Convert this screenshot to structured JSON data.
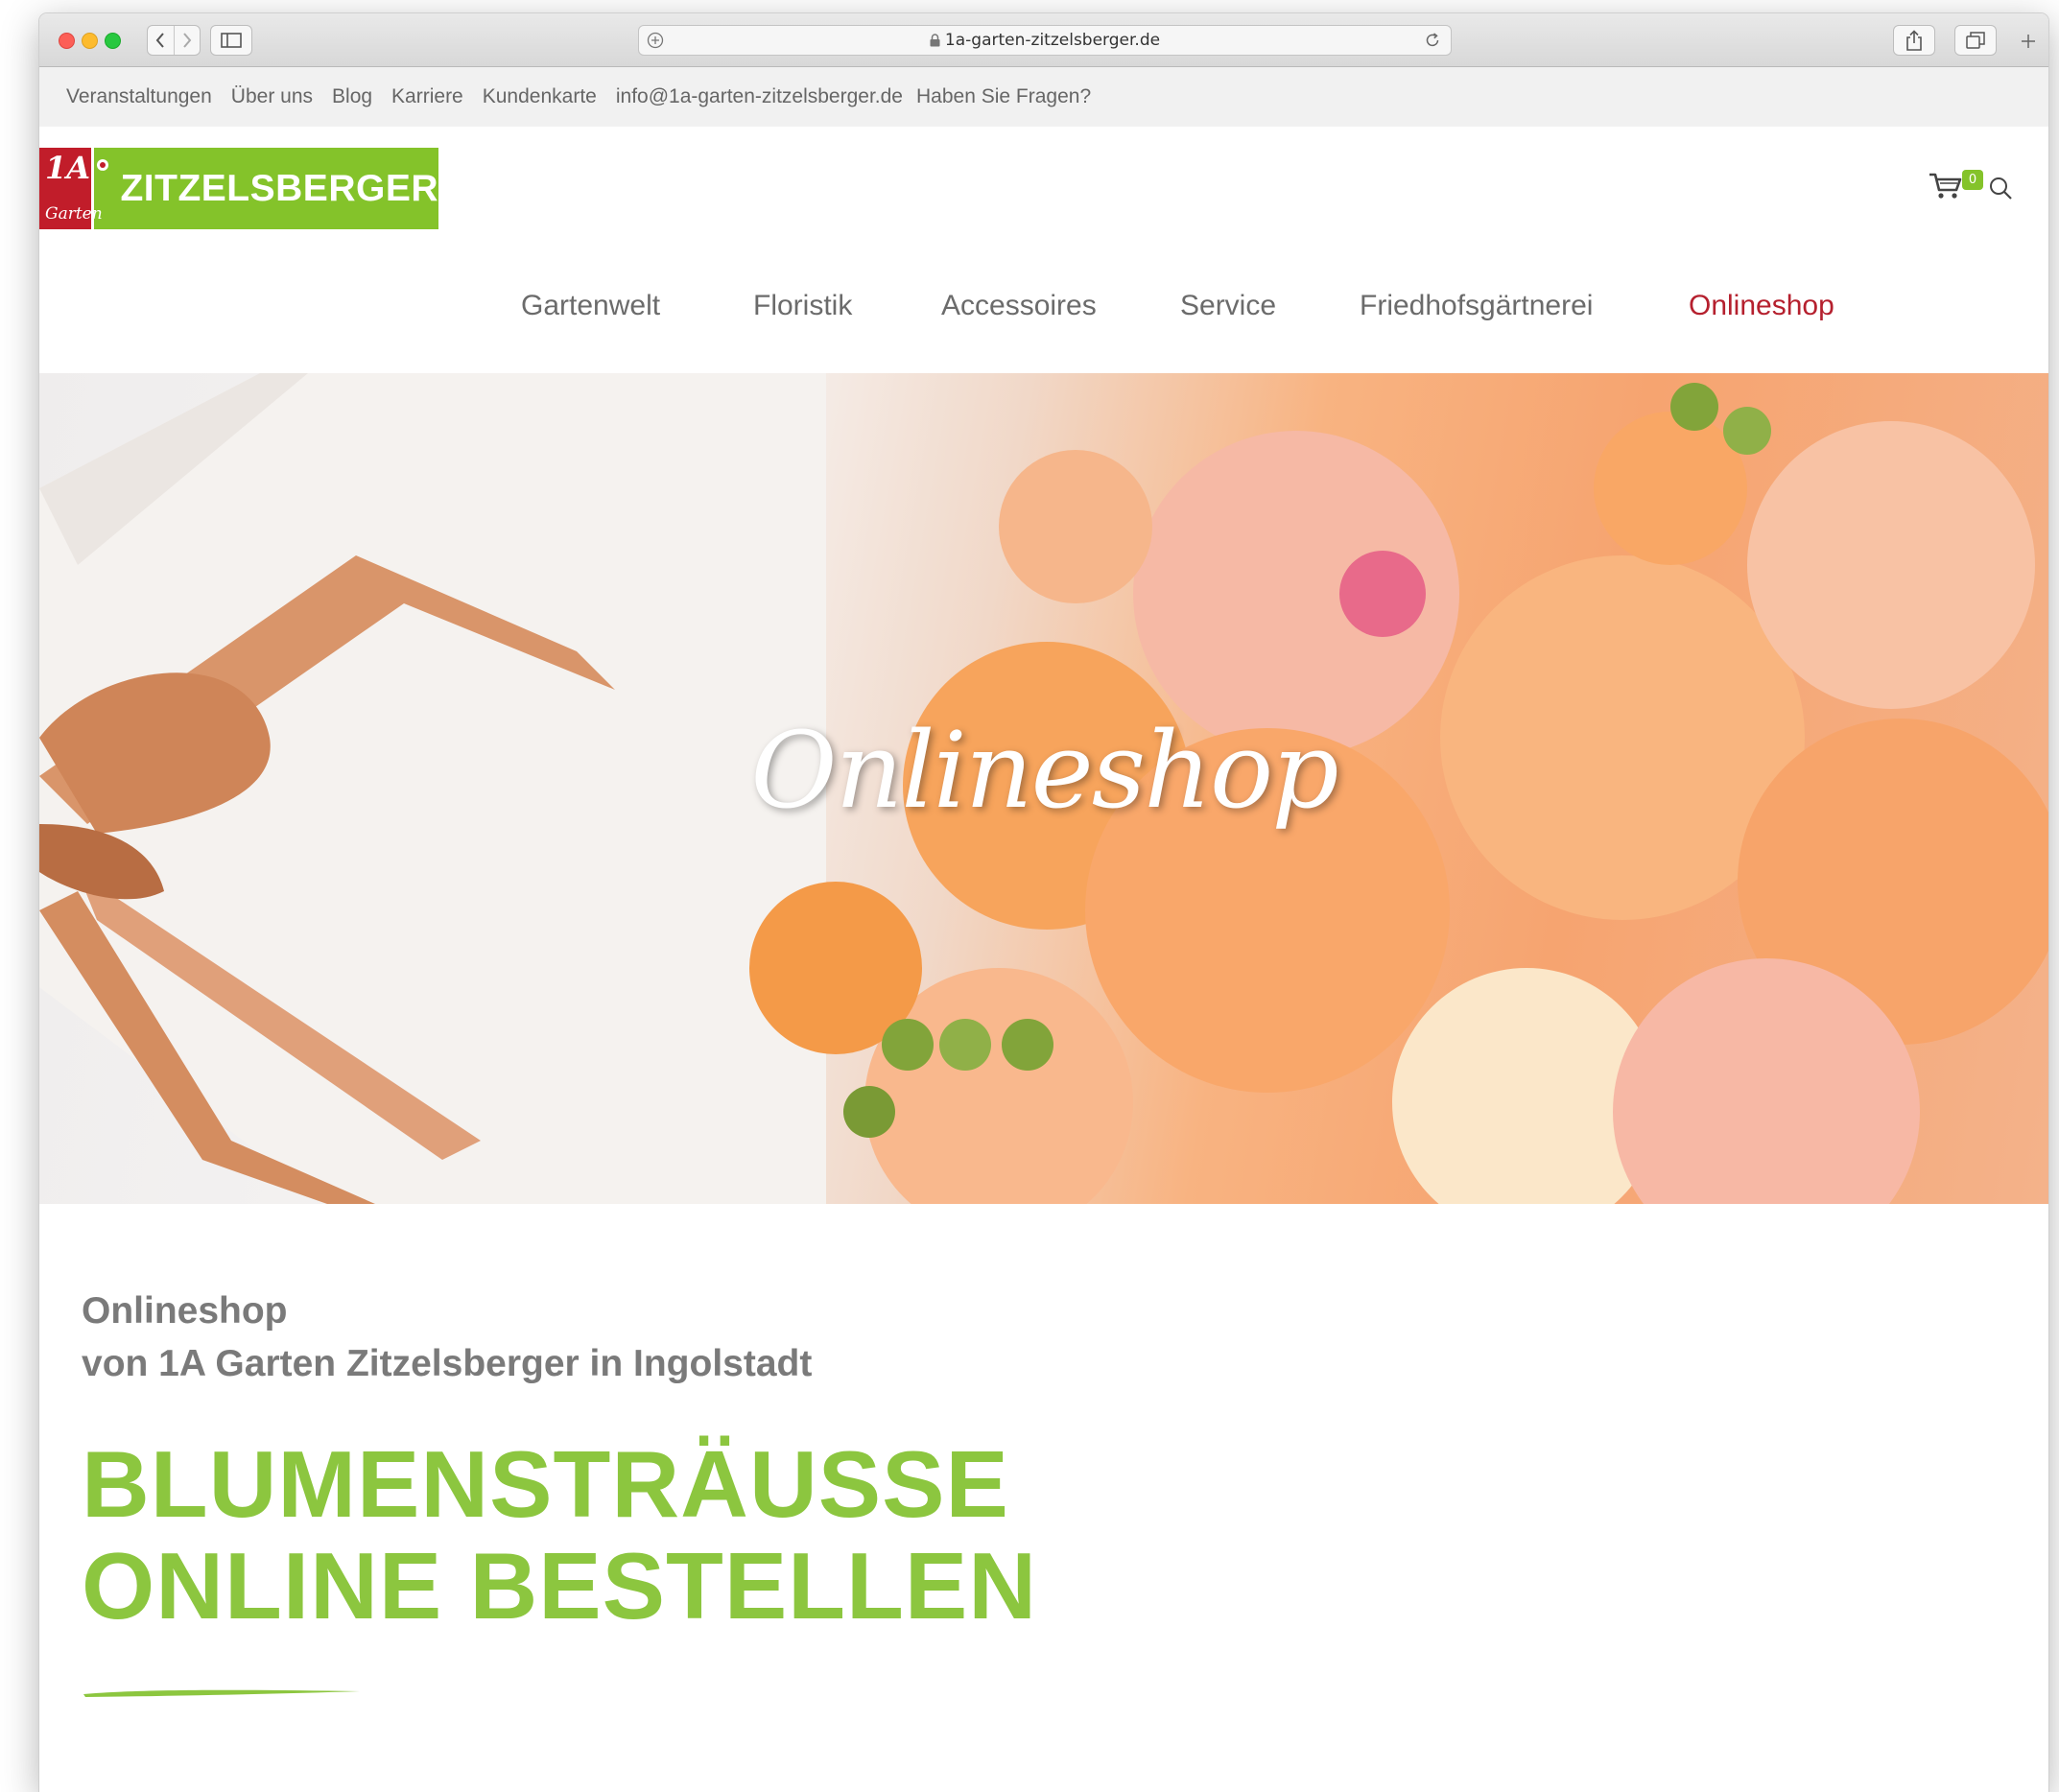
{
  "browser": {
    "url": "1a-garten-zitzelsberger.de"
  },
  "topbar": {
    "links": [
      "Veranstaltungen",
      "Über uns",
      "Blog",
      "Karriere",
      "Kundenkarte",
      "info@1a-garten-zitzelsberger.de",
      "Haben Sie Fragen?"
    ]
  },
  "logo": {
    "mark_top": "1A",
    "mark_bottom": "Garten",
    "brand": "ZITZELSBERGER",
    "bg_color": "#84c32a",
    "mark_color": "#c11d2a"
  },
  "header": {
    "cart_count": "0",
    "cart_icon": "cart-icon",
    "search_icon": "search-icon"
  },
  "nav": {
    "items": [
      "Gartenwelt",
      "Floristik",
      "Accessoires",
      "Service",
      "Friedhofsgärtnerei",
      "Onlineshop"
    ],
    "active": "Onlineshop",
    "active_color": "#b5202e"
  },
  "hero": {
    "title": "Onlineshop"
  },
  "content": {
    "subhead_line1": "Onlineshop",
    "subhead_line2": "von 1A Garten Zitzelsberger in Ingolstadt",
    "headline_line1": "BLUMENSTRÄUSSE",
    "headline_line2": "ONLINE BESTELLEN",
    "accent_color": "#8cc63f"
  }
}
